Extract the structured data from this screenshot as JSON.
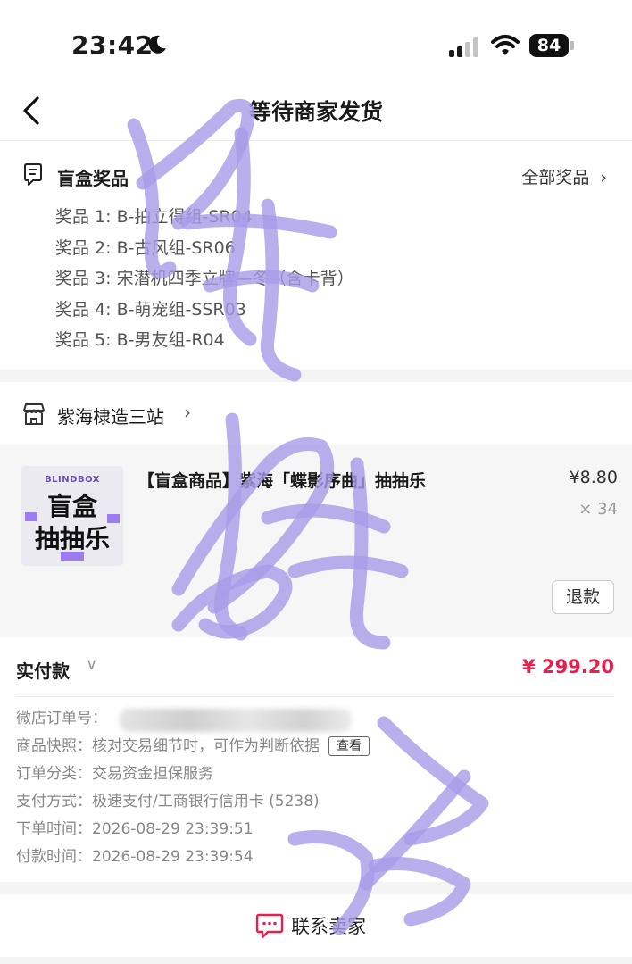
{
  "status_bar": {
    "time": "23:42",
    "battery": "84"
  },
  "nav": {
    "title": "等待商家发货"
  },
  "prizes": {
    "title": "盲盒奖品",
    "all_link": "全部奖品",
    "items": [
      "奖品 1: B-拍立得组-SR04",
      "奖品 2: B-古风组-SR06",
      "奖品 3: 宋潜机四季立牌—冬（含卡背）",
      "奖品 4: B-萌宠组-SSR03",
      "奖品 5: B-男友组-R04"
    ]
  },
  "shop": {
    "name": "紫海棣造三站"
  },
  "product": {
    "thumb_caption": "BLINDBOX",
    "thumb_line1": "盲盒",
    "thumb_line2": "抽抽乐",
    "title": "【盲盒商品】紫海「蝶影序曲」抽抽乐",
    "price": "¥8.80",
    "quantity": "× 34",
    "refund_label": "退款"
  },
  "payment": {
    "label": "实付款",
    "amount": "¥ 299.20"
  },
  "order": {
    "order_no_label": "微店订单号：",
    "snapshot_label": "商品快照：",
    "snapshot_value": "核对交易细节时，可作为判断依据",
    "snapshot_button": "查看",
    "category_label": "订单分类：",
    "category_value": "交易资金担保服务",
    "pay_method_label": "支付方式：",
    "pay_method_value": "极速支付/工商银行信用卡 (5238)",
    "order_time_label": "下单时间：",
    "order_time_value": "2026-08-29 23:39:51",
    "pay_time_label": "付款时间：",
    "pay_time_value": "2026-08-29 23:39:54"
  },
  "contact": {
    "label": "联系卖家"
  },
  "colors": {
    "accent_red": "#e8204d",
    "watermark": "#a99be8"
  },
  "icons": [
    "moon-icon",
    "signal-icon",
    "wifi-icon",
    "back-icon",
    "prize-list-icon",
    "chevron-right-icon",
    "shop-icon",
    "chevron-down-icon",
    "chat-icon"
  ]
}
